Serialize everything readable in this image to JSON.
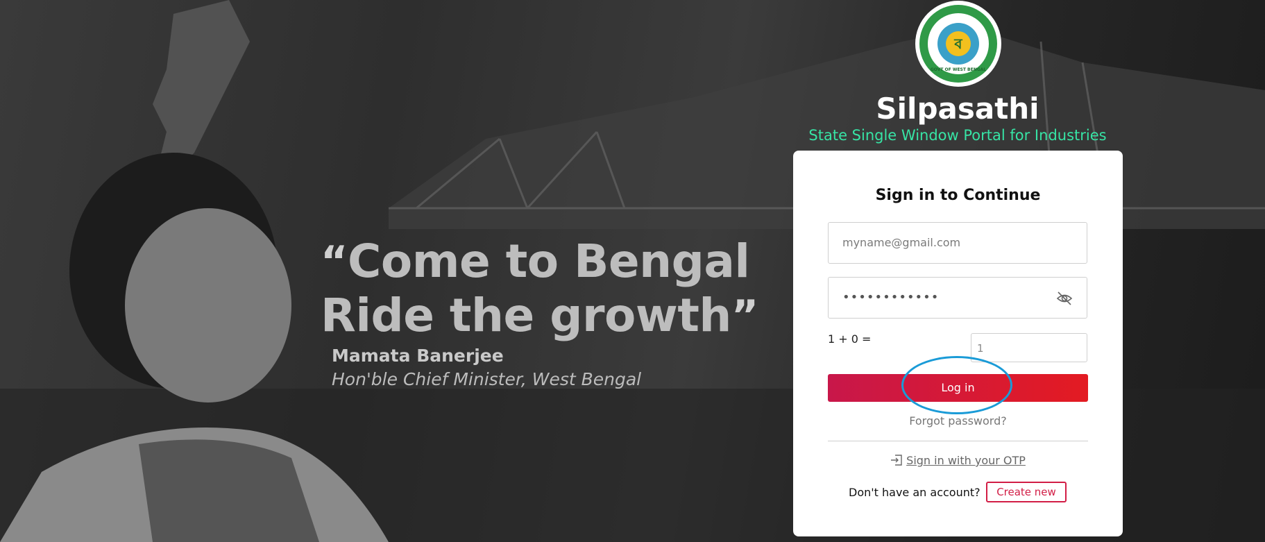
{
  "quote": {
    "line1": "Come to Bengal",
    "line2": "Ride the growth",
    "author": "Mamata Banerjee",
    "author_role": "Hon'ble Chief Minister, West Bengal"
  },
  "brand": {
    "title": "Silpasathi",
    "subtitle": "State Single Window Portal for Industries",
    "emblem_text": "GOVT OF WEST BENGAL",
    "subtitle_color": "#37e4a5"
  },
  "login": {
    "heading": "Sign in to Continue",
    "email_placeholder": "myname@gmail.com",
    "password_masked": "••••••••••••",
    "captcha_question": "1 + 0 =",
    "captcha_value": "1",
    "login_label": "Log in",
    "forgot_label": "Forgot password?",
    "otp_label": "Sign in with your OTP",
    "no_account_text": "Don't have an account?",
    "create_label": "Create new",
    "button_gradient": [
      "#c8174a",
      "#e31b22"
    ],
    "highlight_color": "#1a9bd7"
  }
}
